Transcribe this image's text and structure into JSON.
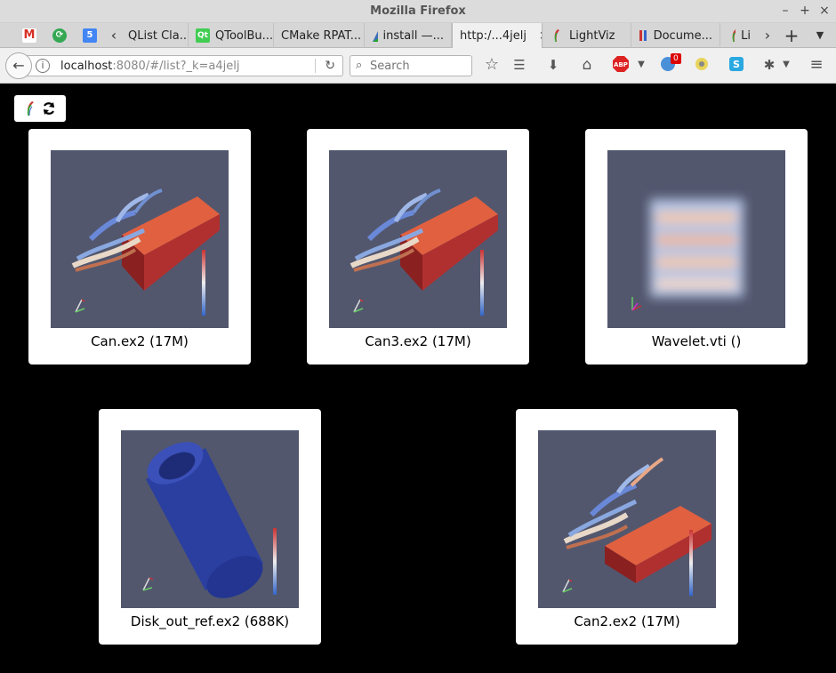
{
  "window": {
    "title": "Mozilla Firefox"
  },
  "tabs": [
    {
      "label": "QList Cla...",
      "favicon": "qt-doc-icon"
    },
    {
      "label": "QToolBu...",
      "favicon": "qt-icon"
    },
    {
      "label": "CMake RPAT...",
      "favicon": "cmake-icon"
    },
    {
      "label": "install —...",
      "favicon": "cmake-triangle-icon"
    },
    {
      "label": "http:/...4jelj",
      "favicon": "none",
      "active": true
    },
    {
      "label": "LightViz",
      "favicon": "lightviz-icon"
    },
    {
      "label": "Docume...",
      "favicon": "docs-icon"
    },
    {
      "label": "Li",
      "favicon": "lightviz-icon"
    }
  ],
  "navbar": {
    "url_host": "localhost",
    "url_rest": ":8080/#/list?_k=a4jelj",
    "search_placeholder": "Search",
    "notification_count": "0"
  },
  "datasets": [
    {
      "label": "Can.ex2 (17M)",
      "kind": "can"
    },
    {
      "label": "Can3.ex2 (17M)",
      "kind": "can"
    },
    {
      "label": "Wavelet.vti ()",
      "kind": "wavelet"
    },
    {
      "label": "Disk_out_ref.ex2 (688K)",
      "kind": "disk"
    },
    {
      "label": "Can2.ex2 (17M)",
      "kind": "can"
    }
  ],
  "colors": {
    "thumbnail_bg": "#52576e",
    "page_bg": "#000000",
    "card_bg": "#ffffff"
  }
}
